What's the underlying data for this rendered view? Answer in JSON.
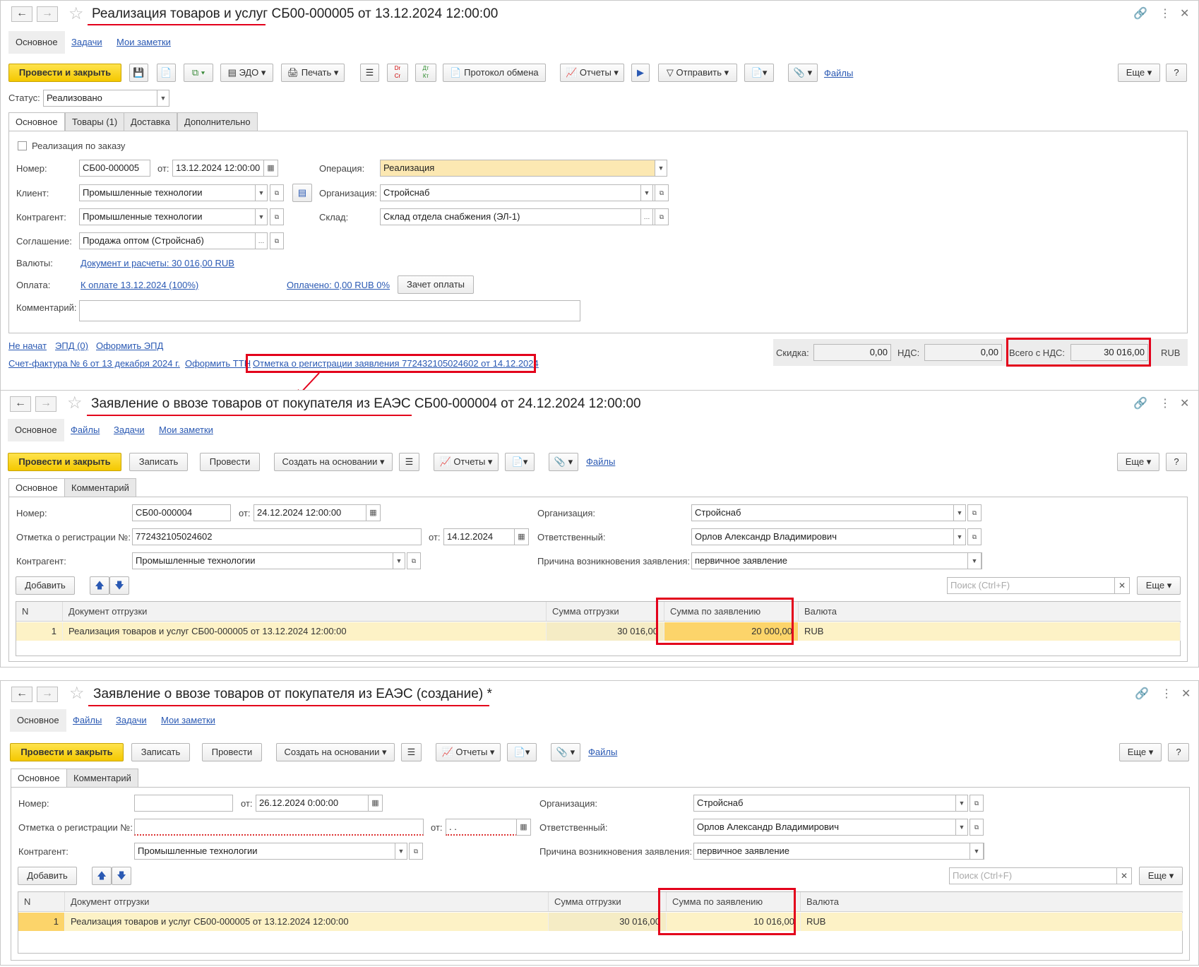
{
  "win1": {
    "title": "Реализация товаров и услуг СБ00-000005 от 13.12.2024 12:00:00",
    "subtabs": [
      "Основное",
      "Задачи",
      "Мои заметки"
    ],
    "tb": {
      "post_close": "Провести и закрыть",
      "edo": "ЭДО",
      "print": "Печать",
      "protocol": "Протокол обмена",
      "reports": "Отчеты",
      "send": "Отправить",
      "files": "Файлы",
      "more": "Еще",
      "help": "?",
      "dtkt1": "Dr\nCr",
      "dtkt2": "Дт\nКт"
    },
    "status_label": "Статус:",
    "status_value": "Реализовано",
    "tabs": [
      "Основное",
      "Товары (1)",
      "Доставка",
      "Дополнительно"
    ],
    "by_order": "Реализация по заказу",
    "labels": {
      "number": "Номер:",
      "from": "от:",
      "client": "Клиент:",
      "contractor": "Контрагент:",
      "agreement": "Соглашение:",
      "currency": "Валюты:",
      "payment": "Оплата:",
      "comment": "Комментарий:",
      "operation": "Операция:",
      "org": "Организация:",
      "warehouse": "Склад:"
    },
    "values": {
      "number": "СБ00-000005",
      "date": "13.12.2024 12:00:00",
      "client": "Промышленные технологии",
      "contractor": "Промышленные технологии",
      "agreement": "Продажа оптом (Стройснаб)",
      "operation": "Реализация",
      "org": "Стройснаб",
      "warehouse": "Склад отдела снабжения (ЭЛ-1)",
      "comment": ""
    },
    "currency_link": "Документ и расчеты: 30 016,00 RUB",
    "payment_link": "К оплате 13.12.2024 (100%)",
    "paid_link": "Оплачено: 0,00 RUB 0%",
    "offset_btn": "Зачет оплаты",
    "footer": {
      "not_started": "Не начат",
      "epd": "ЭПД (0)",
      "make_epd": "Оформить ЭПД",
      "invoice": "Счет-фактура № 6 от 13 декабря 2024 г.",
      "make_ttn": "Оформить ТТН",
      "reg_mark": "Отметка о регистрации заявления 772432105024602 от 14.12.2024"
    },
    "totals": {
      "discount_label": "Скидка:",
      "discount": "0,00",
      "vat_label": "НДС:",
      "vat": "0,00",
      "total_label": "Всего с НДС:",
      "total": "30 016,00",
      "cur": "RUB"
    }
  },
  "win2": {
    "title": "Заявление о ввозе товаров от покупателя из ЕАЭС СБ00-000004 от 24.12.2024 12:00:00",
    "subtabs": [
      "Основное",
      "Файлы",
      "Задачи",
      "Мои заметки"
    ],
    "tb": {
      "post_close": "Провести и закрыть",
      "write": "Записать",
      "post": "Провести",
      "create_base": "Создать на основании",
      "reports": "Отчеты",
      "files": "Файлы",
      "more": "Еще",
      "help": "?"
    },
    "tabs": [
      "Основное",
      "Комментарий"
    ],
    "labels": {
      "number": "Номер:",
      "from": "от:",
      "reg_no": "Отметка о регистрации №:",
      "reg_from": "от:",
      "contractor": "Контрагент:",
      "org": "Организация:",
      "resp": "Ответственный:",
      "reason": "Причина возникновения заявления:"
    },
    "values": {
      "number": "СБ00-000004",
      "date": "24.12.2024 12:00:00",
      "reg_no": "772432105024602",
      "reg_date": "14.12.2024",
      "contractor": "Промышленные технологии",
      "org": "Стройснаб",
      "resp": "Орлов Александр Владимирович",
      "reason": "первичное заявление"
    },
    "add": "Добавить",
    "search_ph": "Поиск (Ctrl+F)",
    "more2": "Еще",
    "columns": [
      "N",
      "Документ отгрузки",
      "Сумма отгрузки",
      "Сумма по заявлению",
      "Валюта"
    ],
    "rows": [
      {
        "n": "1",
        "doc": "Реализация товаров и услуг СБ00-000005 от 13.12.2024 12:00:00",
        "ship": "30 016,00",
        "claim": "20 000,00",
        "cur": "RUB"
      }
    ]
  },
  "win3": {
    "title": "Заявление о ввозе товаров от покупателя из ЕАЭС (создание) *",
    "subtabs": [
      "Основное",
      "Файлы",
      "Задачи",
      "Мои заметки"
    ],
    "tb": {
      "post_close": "Провести и закрыть",
      "write": "Записать",
      "post": "Провести",
      "create_base": "Создать на основании",
      "reports": "Отчеты",
      "files": "Файлы",
      "more": "Еще",
      "help": "?"
    },
    "tabs": [
      "Основное",
      "Комментарий"
    ],
    "labels": {
      "number": "Номер:",
      "from": "от:",
      "reg_no": "Отметка о регистрации №:",
      "reg_from": "от:",
      "contractor": "Контрагент:",
      "org": "Организация:",
      "resp": "Ответственный:",
      "reason": "Причина возникновения заявления:"
    },
    "values": {
      "number": "",
      "date": "26.12.2024  0:00:00",
      "reg_no": "",
      "reg_date": " .  .",
      "contractor": "Промышленные технологии",
      "org": "Стройснаб",
      "resp": "Орлов Александр Владимирович",
      "reason": "первичное заявление"
    },
    "add": "Добавить",
    "search_ph": "Поиск (Ctrl+F)",
    "more2": "Еще",
    "columns": [
      "N",
      "Документ отгрузки",
      "Сумма отгрузки",
      "Сумма по заявлению",
      "Валюта"
    ],
    "rows": [
      {
        "n": "1",
        "doc": "Реализация товаров и услуг СБ00-000005 от 13.12.2024 12:00:00",
        "ship": "30 016,00",
        "claim": "10 016,00",
        "cur": "RUB"
      }
    ]
  }
}
